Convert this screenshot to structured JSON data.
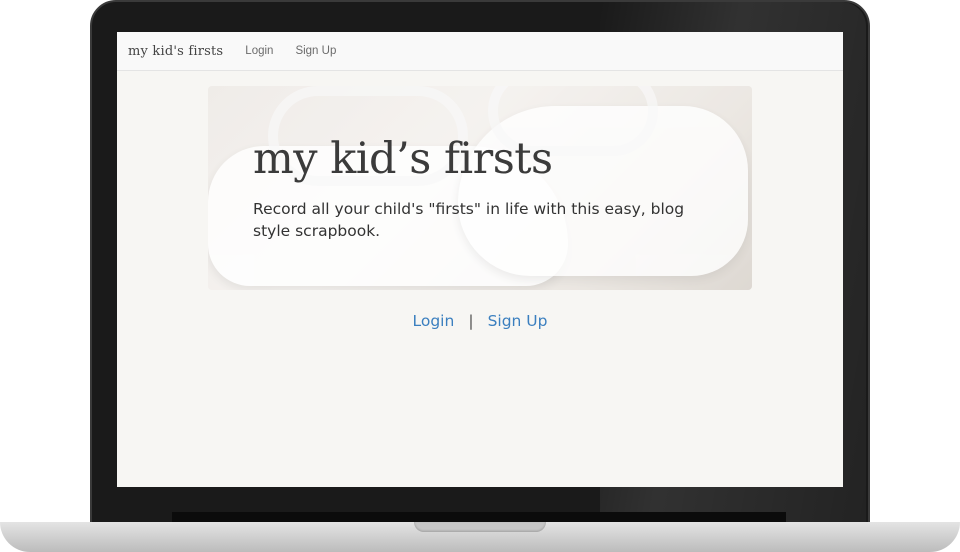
{
  "navbar": {
    "brand": "my kid's firsts",
    "links": [
      "Login",
      "Sign Up"
    ]
  },
  "hero": {
    "title": "my kid’s firsts",
    "subtitle": "Record all your child's \"firsts\" in life with this easy, blog style scrapbook."
  },
  "auth": {
    "login": "Login",
    "separator": "|",
    "signup": "Sign Up"
  },
  "colors": {
    "link": "#3b7fbf",
    "page_bg": "#f7f6f3",
    "navbar_bg": "#f9f9f9"
  }
}
